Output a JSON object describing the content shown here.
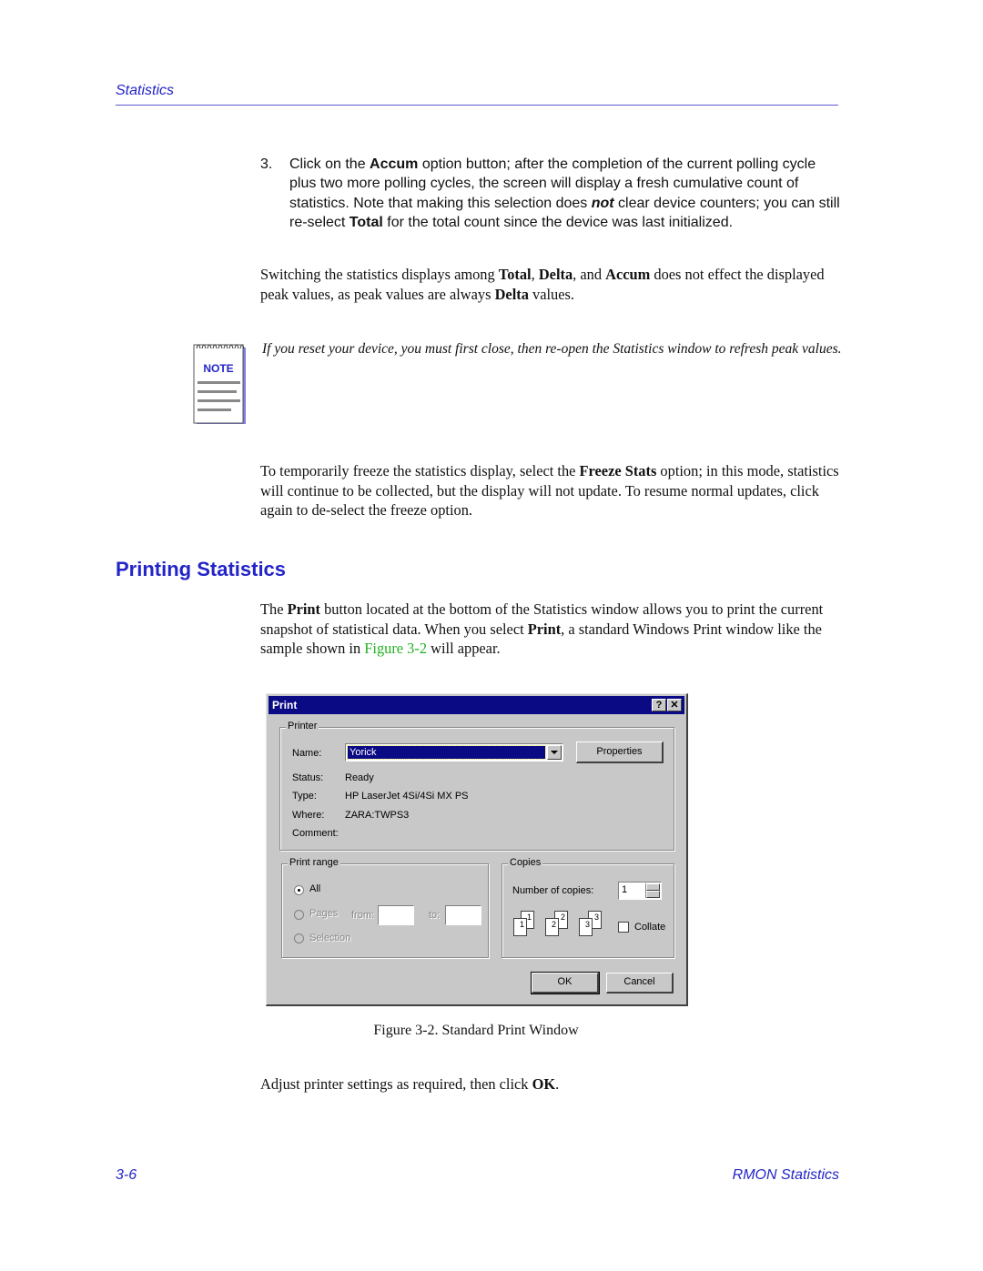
{
  "header": {
    "section_title": "Statistics"
  },
  "step3": {
    "number": "3.",
    "parts": [
      "Click on the ",
      "Accum",
      " option button; after the completion of the current polling cycle plus two more polling cycles, the screen will display a fresh cumulative count of statistics. Note that making this selection does ",
      "not",
      " clear device counters; you can still re-select ",
      "Total",
      " for the total count since the device was last initialized."
    ]
  },
  "para_switching": {
    "parts": [
      "Switching the statistics displays among ",
      "Total",
      ", ",
      "Delta",
      ", and ",
      "Accum",
      " does not effect the displayed peak values, as peak values are always ",
      "Delta",
      " values."
    ]
  },
  "note": {
    "icon_label": "NOTE",
    "text": "If you reset your device, you must first close, then re-open the Statistics window to refresh peak values."
  },
  "para_freeze": {
    "parts": [
      "To temporarily freeze the statistics display, select the ",
      "Freeze Stats",
      " option; in this mode, statistics will continue to be collected, but the display will not update. To resume normal updates, click again to de-select the freeze option."
    ]
  },
  "section": {
    "heading": "Printing Statistics"
  },
  "para_print": {
    "parts": [
      "The ",
      "Print",
      " button located at the bottom of the Statistics window allows you to print the current snapshot of statistical data. When you select ",
      "Print",
      ", a standard Windows Print window like the sample shown in ",
      "Figure 3-2",
      " will appear."
    ]
  },
  "dialog": {
    "title": "Print",
    "help_btn": "?",
    "close_btn": "✕",
    "printer_group": "Printer",
    "name_label": "Name:",
    "name_value": "Yorick",
    "properties_btn": "Properties",
    "status_label": "Status:",
    "status_value": "Ready",
    "type_label": "Type:",
    "type_value": "HP LaserJet 4Si/4Si MX PS",
    "where_label": "Where:",
    "where_value": "ZARA:TWPS3",
    "comment_label": "Comment:",
    "comment_value": "",
    "range_group": "Print range",
    "range_all": "All",
    "range_pages": "Pages",
    "range_from": "from:",
    "range_to": "to:",
    "range_selection": "Selection",
    "from_value": "",
    "to_value": "",
    "copies_group": "Copies",
    "copies_label": "Number of copies:",
    "copies_value": "1",
    "collate_label": "Collate",
    "collate_checked": false,
    "ok_btn": "OK",
    "cancel_btn": "Cancel",
    "pages": [
      "1",
      "1",
      "2",
      "2",
      "3",
      "3"
    ]
  },
  "figure": {
    "caption": "Figure 3-2.  Standard Print Window"
  },
  "para_adjust": {
    "parts": [
      "Adjust printer settings as required, then click ",
      "OK",
      "."
    ]
  },
  "footer": {
    "page_number": "3-6",
    "doc_title": "RMON Statistics"
  },
  "colors": {
    "accent_blue": "#2424c8",
    "link_green": "#22b022",
    "titlebar": "#0a0a84"
  }
}
